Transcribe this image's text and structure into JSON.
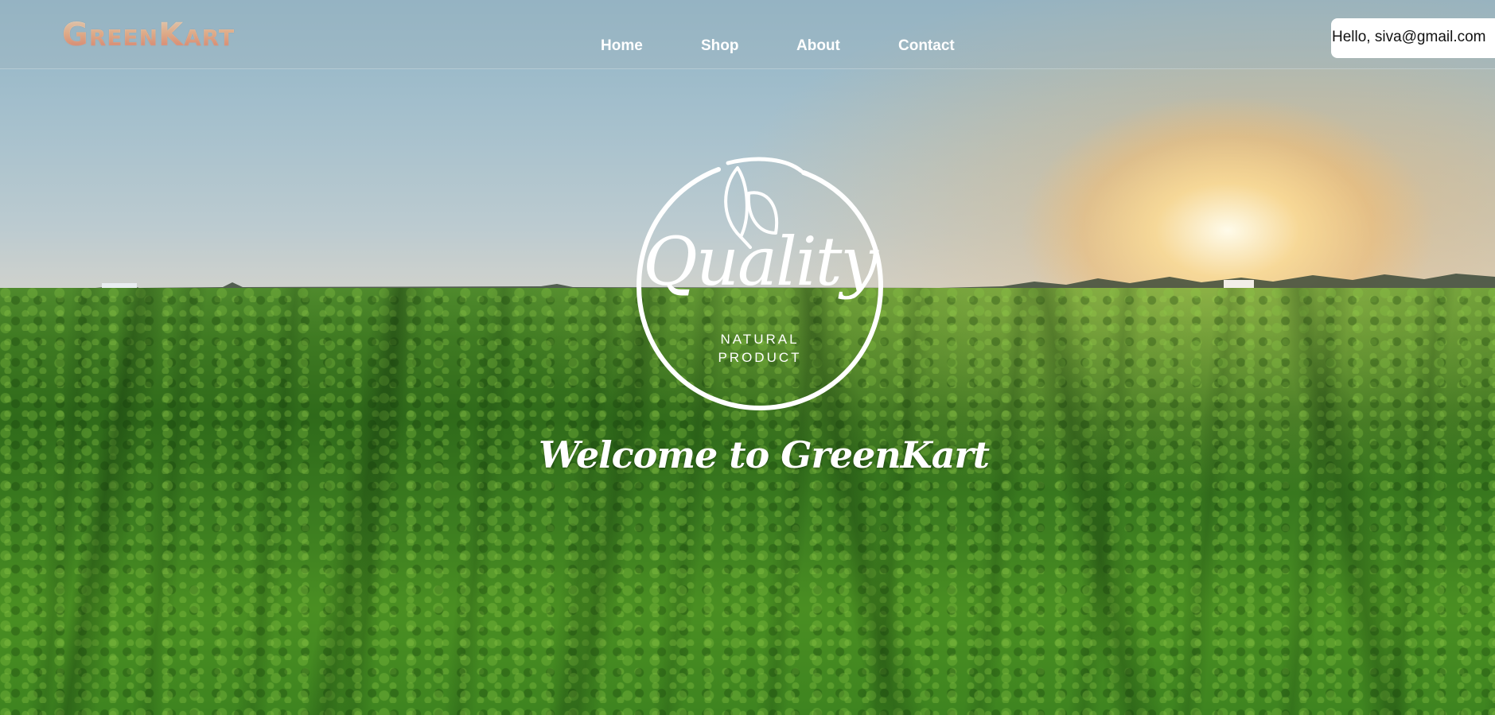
{
  "header": {
    "logo_text": "GreenKart",
    "nav": [
      {
        "label": "Home"
      },
      {
        "label": "Shop"
      },
      {
        "label": "About"
      },
      {
        "label": "Contact"
      }
    ],
    "greeting": "Hello, siva@gmail.com"
  },
  "hero": {
    "emblem_word": "Quality",
    "emblem_line1": "NATURAL",
    "emblem_line2": "PRODUCT",
    "welcome_text": "Welcome to GreenKart"
  },
  "colors": {
    "header_overlay": "#a0b4be",
    "nav_text": "#ffffff",
    "greeting_bg": "#ffffff",
    "sun_glow": "#f6be6e",
    "field_green": "#3f7a22"
  }
}
